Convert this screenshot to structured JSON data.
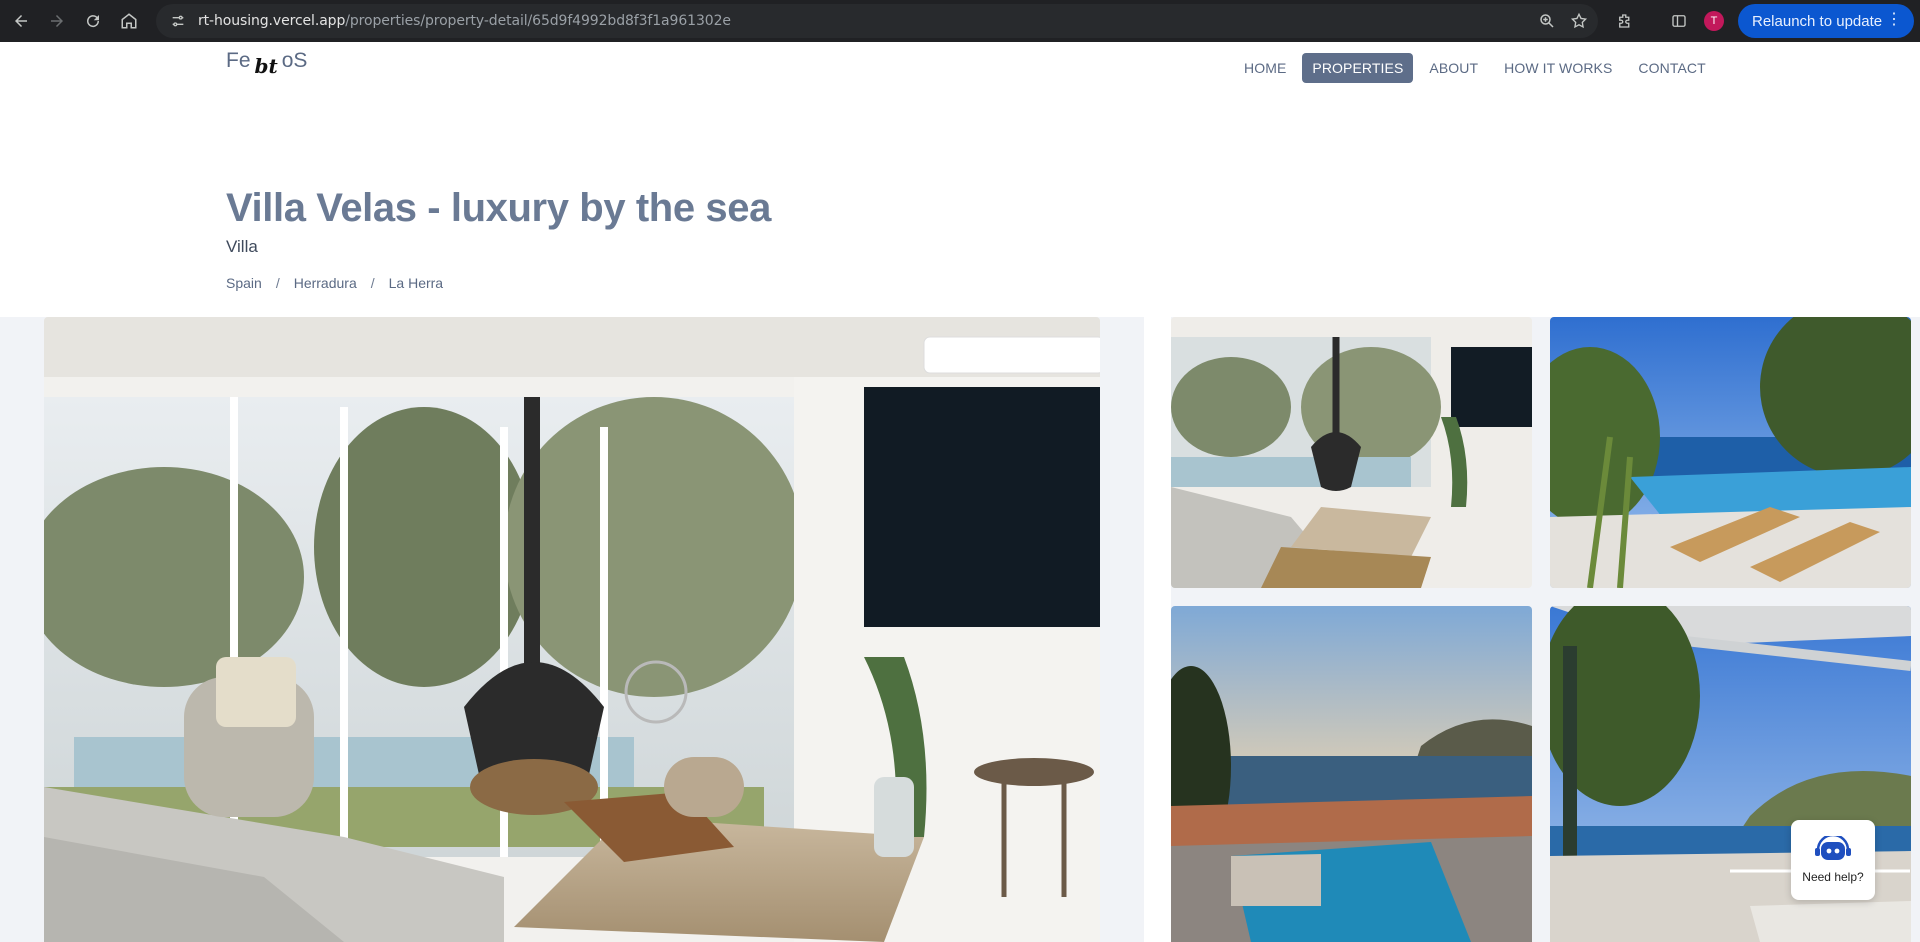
{
  "browser": {
    "url_host": "rt-housing.vercel.app",
    "url_path": "/properties/property-detail/65d9f4992bd8f3f1a961302e",
    "profile_initial": "T",
    "relaunch_label": "Relaunch to update"
  },
  "site": {
    "logo_left": "Fe",
    "logo_mark": "bt",
    "logo_right": "oS",
    "nav": [
      {
        "label": "HOME",
        "active": false
      },
      {
        "label": "PROPERTIES",
        "active": true
      },
      {
        "label": "ABOUT",
        "active": false
      },
      {
        "label": "HOW IT WORKS",
        "active": false
      },
      {
        "label": "CONTACT",
        "active": false
      }
    ]
  },
  "property": {
    "title": "Villa Velas - luxury by the sea",
    "type": "Villa",
    "breadcrumb": [
      "Spain",
      "Herradura",
      "La Herra"
    ]
  },
  "gallery": {
    "photos": [
      "living-room-main",
      "living-room",
      "pool-terrace",
      "sunset-pool",
      "terrace-view"
    ]
  },
  "help": {
    "label": "Need help?"
  },
  "colors": {
    "accent": "#5e6e8a",
    "title": "#6a7a94",
    "chrome": "#202124",
    "relaunch": "#0b57d0"
  }
}
